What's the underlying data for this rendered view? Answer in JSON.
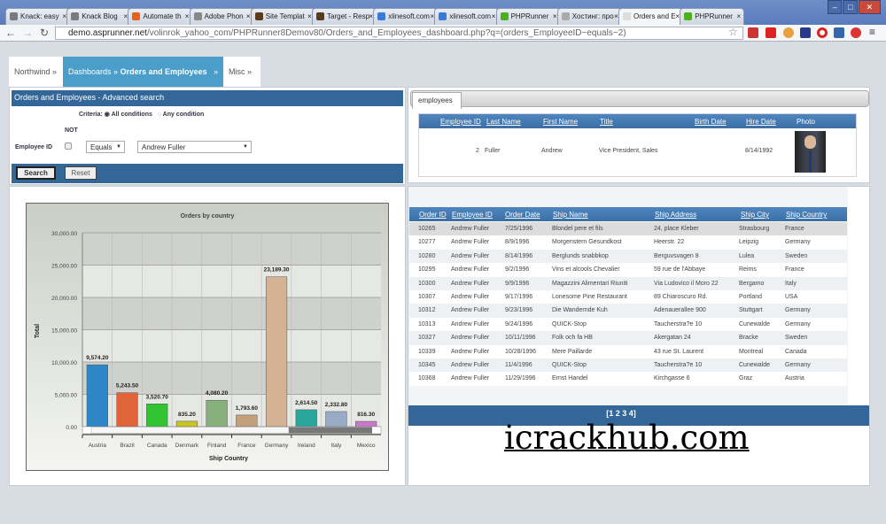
{
  "browser": {
    "tabs": [
      {
        "label": "Knack: easy",
        "color": "#7a7a7a"
      },
      {
        "label": "Knack Blog",
        "color": "#7a7a7a"
      },
      {
        "label": "Automate th",
        "color": "#e8611c"
      },
      {
        "label": "Adobe Phon",
        "color": "#888"
      },
      {
        "label": "Site Templat",
        "color": "#5a3a1a"
      },
      {
        "label": "Target - Resp",
        "color": "#5a3a1a"
      },
      {
        "label": "xlinesoft.com",
        "color": "#3a7ad8"
      },
      {
        "label": "xlinesoft.com",
        "color": "#3a7ad8"
      },
      {
        "label": "PHPRunner",
        "color": "#4caf1c"
      },
      {
        "label": "Хостинг: про",
        "color": "#aaa"
      },
      {
        "label": "Orders and E",
        "color": "#ddd"
      },
      {
        "label": "PHPRunner",
        "color": "#4caf1c"
      }
    ],
    "active_tab": 10,
    "url_host": "demo.asprunner.net",
    "url_path": "/volinrok_yahoo_com/PHPRunner8Demov80/Orders_and_Employees_dashboard.php?q=(orders_EmployeeID~equals~2)"
  },
  "menu": {
    "northwind": "Northwind",
    "dashboards": "Dashboards",
    "current": "Orders and Employees",
    "misc": "Misc",
    "sep": "»"
  },
  "search": {
    "title": "Orders and Employees - Advanced search",
    "criteria_label": "Criteria:",
    "all_conditions": "All conditions",
    "any_condition": "Any condition",
    "not_label": "NOT",
    "field_label": "Employee ID",
    "operator": "Equals",
    "value": "Andrew Fuller",
    "search_button": "Search",
    "reset_button": "Reset"
  },
  "employees": {
    "tab": "employees",
    "columns": [
      "Employee ID",
      "Last Name",
      "First Name",
      "Title",
      "Birth Date",
      "Hire Date",
      "Photo"
    ],
    "row": {
      "id": "2",
      "last": "Fuller",
      "first": "Andrew",
      "title": "Vice President, Sales",
      "birth": "",
      "hire": "8/14/1992"
    }
  },
  "orders": {
    "columns": [
      "Order ID",
      "Employee ID",
      "Order Date",
      "Ship Name",
      "Ship Address",
      "Ship City",
      "Ship Country"
    ],
    "rows": [
      [
        "10265",
        "Andrew Fuller",
        "7/25/1996",
        "Blondel pere et fils",
        "24, place Kleber",
        "Strasbourg",
        "France"
      ],
      [
        "10277",
        "Andrew Fuller",
        "8/9/1996",
        "Morgenstern Gesundkost",
        "Heerstr. 22",
        "Leipzig",
        "Germany"
      ],
      [
        "10280",
        "Andrew Fuller",
        "8/14/1996",
        "Berglunds snabbkop",
        "Berguvsvagen 8",
        "Lulea",
        "Sweden"
      ],
      [
        "10295",
        "Andrew Fuller",
        "9/2/1996",
        "Vins et alcools Chevalier",
        "59 rue de l'Abbaye",
        "Reims",
        "France"
      ],
      [
        "10300",
        "Andrew Fuller",
        "9/9/1996",
        "Magazzini Alimentari Riuniti",
        "Via Ludovico il Moro 22",
        "Bergamo",
        "Italy"
      ],
      [
        "10307",
        "Andrew Fuller",
        "9/17/1996",
        "Lonesome Pine Restaurant",
        "89 Chiaroscuro Rd.",
        "Portland",
        "USA"
      ],
      [
        "10312",
        "Andrew Fuller",
        "9/23/1996",
        "Die Wandernde Kuh",
        "Adenauerallee 900",
        "Stuttgart",
        "Germany"
      ],
      [
        "10313",
        "Andrew Fuller",
        "9/24/1996",
        "QUICK-Stop",
        "Taucherstra?e 10",
        "Cunewalde",
        "Germany"
      ],
      [
        "10327",
        "Andrew Fuller",
        "10/11/1996",
        "Folk och fa HB",
        "Akergatan 24",
        "Bracke",
        "Sweden"
      ],
      [
        "10339",
        "Andrew Fuller",
        "10/28/1996",
        "Mere Paillarde",
        "43 rue St. Laurent",
        "Montreal",
        "Canada"
      ],
      [
        "10345",
        "Andrew Fuller",
        "11/4/1996",
        "QUICK-Stop",
        "Taucherstra?e 10",
        "Cunewalde",
        "Germany"
      ],
      [
        "10368",
        "Andrew Fuller",
        "11/29/1996",
        "Ernst Handel",
        "Kirchgasse 6",
        "Graz",
        "Austria"
      ]
    ],
    "pagination": "[1 2 3 4]"
  },
  "watermark": "icrackhub.com",
  "chart_data": {
    "type": "bar",
    "title": "Orders by country",
    "xlabel": "Ship Country",
    "ylabel": "Total",
    "ylim": [
      0,
      30000
    ],
    "yticks": [
      "0.00",
      "5,000.00",
      "10,000.00",
      "15,000.00",
      "20,000.00",
      "25,000.00",
      "30,000.00"
    ],
    "categories": [
      "Austria",
      "Brazil",
      "Canada",
      "Denmark",
      "Finland",
      "France",
      "Germany",
      "Ireland",
      "Italy",
      "Mexico"
    ],
    "values": [
      9574.2,
      5243.5,
      3520.7,
      835.2,
      4080.2,
      1793.6,
      23189.3,
      2614.5,
      2332.8,
      816.3
    ],
    "labels": [
      "9,574.20",
      "5,243.50",
      "3,520.70",
      "835.20",
      "4,080.20",
      "1,793.60",
      "23,189.30",
      "2,614.50",
      "2,332.80",
      "816.30"
    ],
    "colors": [
      "#2f86c6",
      "#e0643a",
      "#33c433",
      "#c9c422",
      "#86b07c",
      "#c3a07a",
      "#d4b294",
      "#2aa79c",
      "#98acc8",
      "#c87ac8"
    ],
    "grid": true,
    "legend": "none"
  }
}
